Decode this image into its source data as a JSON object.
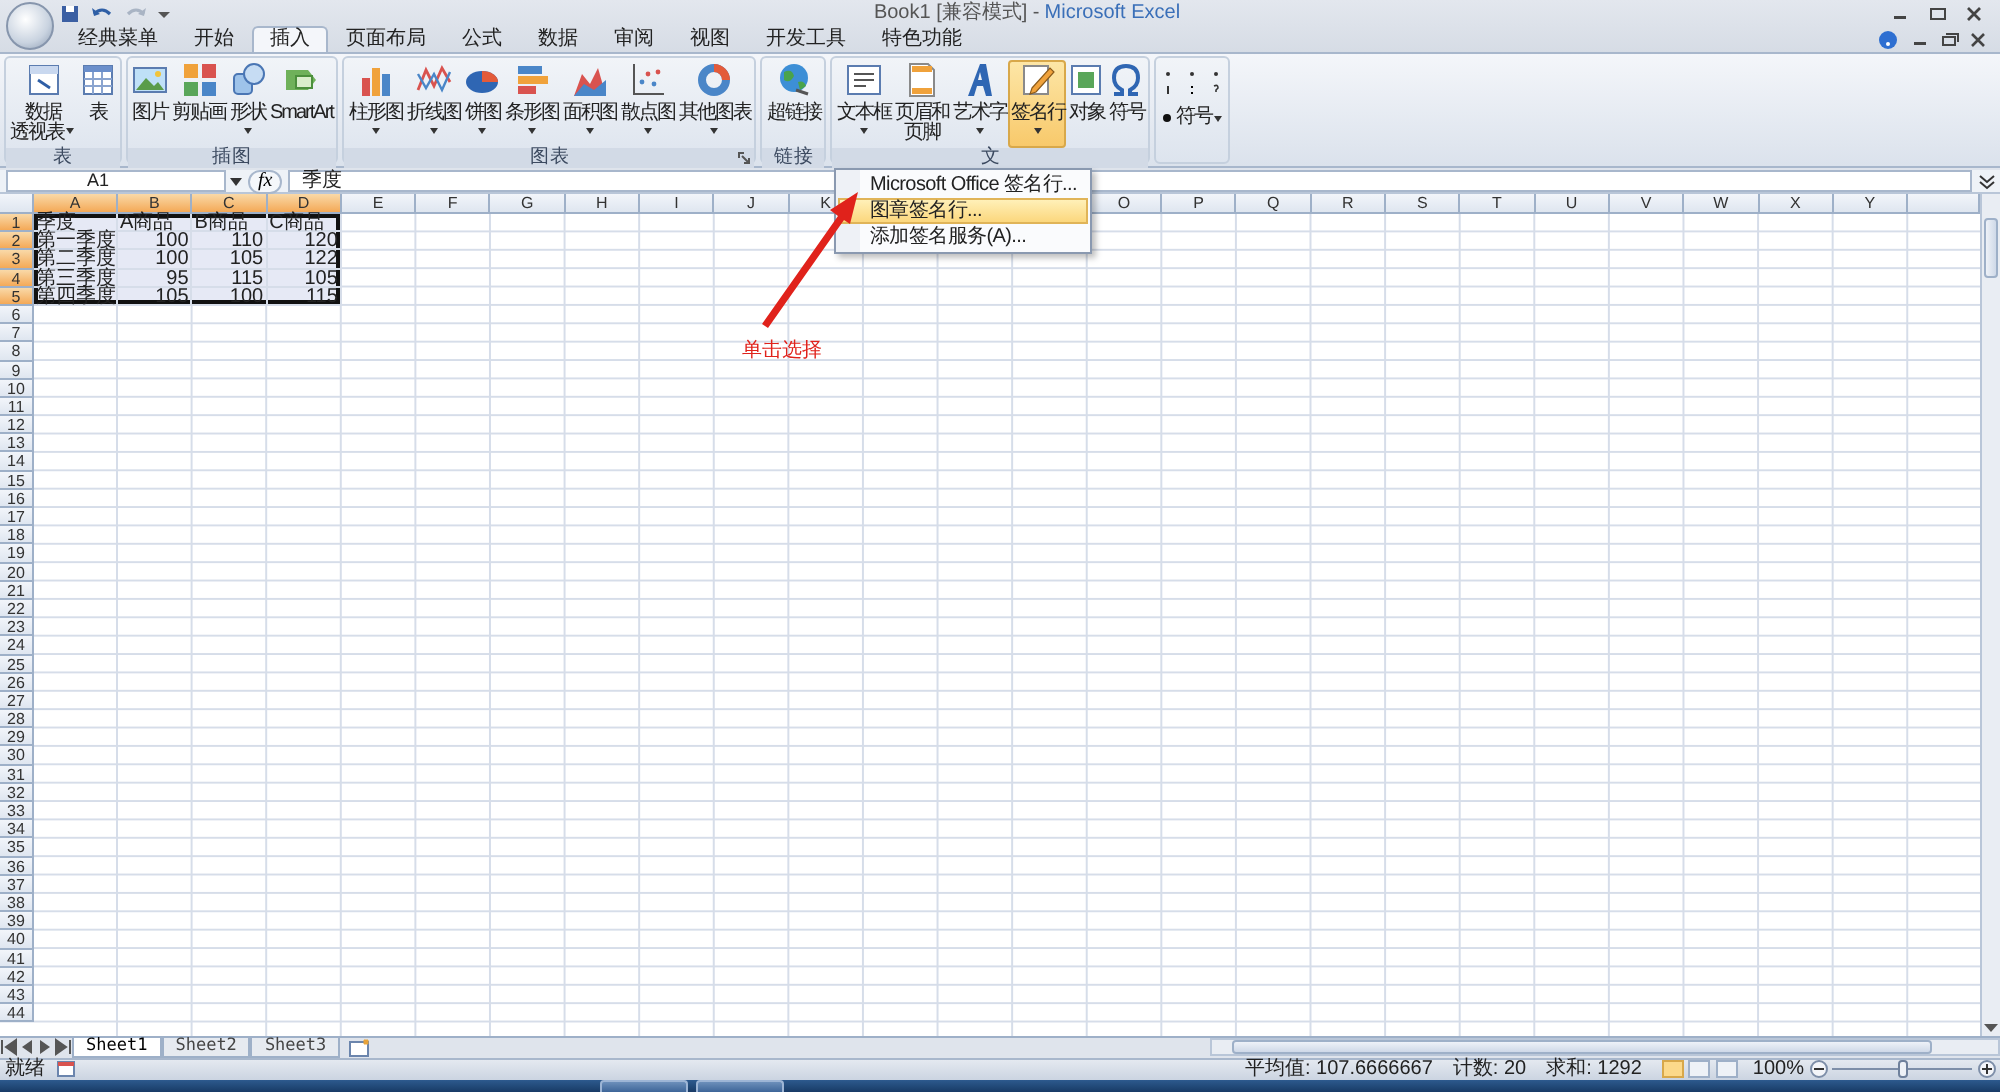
{
  "window": {
    "title_parts": [
      {
        "text": "Book1  [兼容模式]  -",
        "kind": "document"
      },
      {
        "text": "Microsoft Excel",
        "kind": "app"
      }
    ]
  },
  "tabs": [
    {
      "label": "经典菜单",
      "selected": false
    },
    {
      "label": "开始",
      "selected": false
    },
    {
      "label": "插入",
      "selected": true
    },
    {
      "label": "页面布局",
      "selected": false
    },
    {
      "label": "公式",
      "selected": false
    },
    {
      "label": "数据",
      "selected": false
    },
    {
      "label": "审阅",
      "selected": false
    },
    {
      "label": "视图",
      "selected": false
    },
    {
      "label": "开发工具",
      "selected": false
    },
    {
      "label": "特色功能",
      "selected": false
    }
  ],
  "ribbon": {
    "groups": [
      {
        "label": "表",
        "launcher": false,
        "buttons": [
          {
            "kind": "large",
            "lines": [
              "数据",
              "透视表"
            ],
            "dropdown": true,
            "pressed": false
          },
          {
            "kind": "large",
            "lines": [
              "表"
            ],
            "dropdown": false,
            "pressed": false
          }
        ]
      },
      {
        "label": "插图",
        "launcher": false,
        "buttons": [
          {
            "kind": "large",
            "lines": [
              "图片"
            ],
            "dropdown": false,
            "pressed": false
          },
          {
            "kind": "large",
            "lines": [
              "剪贴画"
            ],
            "dropdown": false,
            "pressed": false
          },
          {
            "kind": "large",
            "lines": [
              "形状"
            ],
            "dropdown": true,
            "pressed": false
          },
          {
            "kind": "large",
            "lines": [
              "SmartArt"
            ],
            "dropdown": false,
            "pressed": false
          }
        ]
      },
      {
        "label": "图表",
        "launcher": true,
        "buttons": [
          {
            "kind": "large",
            "lines": [
              "柱形图"
            ],
            "dropdown": true,
            "pressed": false
          },
          {
            "kind": "large",
            "lines": [
              "折线图"
            ],
            "dropdown": true,
            "pressed": false
          },
          {
            "kind": "large",
            "lines": [
              "饼图"
            ],
            "dropdown": true,
            "pressed": false
          },
          {
            "kind": "large",
            "lines": [
              "条形图"
            ],
            "dropdown": true,
            "pressed": false
          },
          {
            "kind": "large",
            "lines": [
              "面积图"
            ],
            "dropdown": true,
            "pressed": false
          },
          {
            "kind": "large",
            "lines": [
              "散点图"
            ],
            "dropdown": true,
            "pressed": false
          },
          {
            "kind": "large",
            "lines": [
              "其他图表"
            ],
            "dropdown": true,
            "pressed": false
          }
        ]
      },
      {
        "label": "链接",
        "launcher": false,
        "buttons": [
          {
            "kind": "large",
            "lines": [
              "超链接"
            ],
            "dropdown": false,
            "pressed": false
          }
        ]
      },
      {
        "label": "文",
        "launcher": false,
        "buttons": [
          {
            "kind": "large",
            "lines": [
              "文本框"
            ],
            "dropdown": true,
            "pressed": false
          },
          {
            "kind": "large",
            "lines": [
              "页眉和",
              "页脚"
            ],
            "dropdown": false,
            "pressed": false
          },
          {
            "kind": "large",
            "lines": [
              "艺术字"
            ],
            "dropdown": true,
            "pressed": false
          },
          {
            "kind": "large",
            "lines": [
              "签名行"
            ],
            "dropdown": true,
            "pressed": true,
            "menu": true
          },
          {
            "kind": "large",
            "lines": [
              "对象"
            ],
            "dropdown": false,
            "pressed": false
          },
          {
            "kind": "large",
            "lines": [
              "符号"
            ],
            "dropdown": false,
            "pressed": false
          }
        ]
      },
      {
        "buttons": [
          {
            "kind": "symbol",
            "lines": [
              "符号"
            ],
            "dropdown": true,
            "pressed": false
          }
        ]
      }
    ]
  },
  "signature_menu": {
    "items": [
      {
        "label": "Microsoft Office 签名行...",
        "selected": false
      },
      {
        "label": "图章签名行...",
        "selected": true
      },
      {
        "label": "添加签名服务(A)...",
        "selected": false
      }
    ]
  },
  "annotation": {
    "text": "单击选择"
  },
  "formula_bar": {
    "name_box": "A1",
    "insert_function": "fx",
    "formula": "季度"
  },
  "sheet": {
    "columns": [
      {
        "label": "A",
        "selected": true
      },
      {
        "label": "B",
        "selected": true
      },
      {
        "label": "C",
        "selected": true
      },
      {
        "label": "D",
        "selected": true
      },
      {
        "label": "E",
        "selected": false
      },
      {
        "label": "F",
        "selected": false
      },
      {
        "label": "G",
        "selected": false
      },
      {
        "label": "H",
        "selected": false
      },
      {
        "label": "I",
        "selected": false
      },
      {
        "label": "J",
        "selected": false
      },
      {
        "label": "K",
        "selected": false
      },
      null,
      null,
      null,
      {
        "label": "O",
        "selected": false
      },
      {
        "label": "P",
        "selected": false
      },
      {
        "label": "Q",
        "selected": false
      },
      {
        "label": "R",
        "selected": false
      },
      {
        "label": "S",
        "selected": false
      },
      {
        "label": "T",
        "selected": false
      },
      {
        "label": "U",
        "selected": false
      },
      {
        "label": "V",
        "selected": false
      },
      {
        "label": "W",
        "selected": false
      },
      {
        "label": "X",
        "selected": false
      },
      {
        "label": "Y",
        "selected": false
      }
    ],
    "rows": [
      {
        "header": "1",
        "selected": true,
        "kind": "heading",
        "cells": [
          "季度",
          "A商品",
          "B商品",
          "C商品"
        ]
      },
      {
        "header": "2",
        "selected": true,
        "kind": "values",
        "cells": [
          "第一季度",
          "100",
          "110",
          "120"
        ]
      },
      {
        "header": "3",
        "selected": true,
        "kind": "values",
        "cells": [
          "第二季度",
          "100",
          "105",
          "122"
        ]
      },
      {
        "header": "4",
        "selected": true,
        "kind": "values",
        "cells": [
          "第三季度",
          "95",
          "115",
          "105"
        ]
      },
      {
        "header": "5",
        "selected": true,
        "kind": "values",
        "cells": [
          "第四季度",
          "105",
          "100",
          "115"
        ]
      },
      {
        "header": "6",
        "selected": false
      },
      {
        "header": "7",
        "selected": false
      },
      {
        "header": "8",
        "selected": false
      },
      {
        "header": "9",
        "selected": false
      },
      {
        "header": "10",
        "selected": false
      },
      {
        "header": "11",
        "selected": false
      },
      {
        "header": "12",
        "selected": false
      },
      {
        "header": "13",
        "selected": false
      },
      {
        "header": "14",
        "selected": false
      },
      {
        "header": "15",
        "selected": false
      },
      {
        "header": "16",
        "selected": false
      },
      {
        "header": "17",
        "selected": false
      },
      {
        "header": "18",
        "selected": false
      },
      {
        "header": "19",
        "selected": false
      },
      {
        "header": "20",
        "selected": false
      },
      {
        "header": "21",
        "selected": false
      },
      {
        "header": "22",
        "selected": false
      },
      {
        "header": "23",
        "selected": false
      },
      {
        "header": "24",
        "selected": false
      },
      {
        "header": "25",
        "selected": false
      },
      {
        "header": "26",
        "selected": false
      },
      {
        "header": "27",
        "selected": false
      },
      {
        "header": "28",
        "selected": false
      },
      {
        "header": "29",
        "selected": false
      },
      {
        "header": "30",
        "selected": false
      },
      {
        "header": "31",
        "selected": false
      },
      {
        "header": "32",
        "selected": false
      },
      {
        "header": "33",
        "selected": false
      },
      {
        "header": "34",
        "selected": false
      },
      {
        "header": "35",
        "selected": false
      },
      {
        "header": "36",
        "selected": false
      },
      {
        "header": "37",
        "selected": false
      },
      {
        "header": "38",
        "selected": false
      },
      {
        "header": "39",
        "selected": false
      },
      {
        "header": "40",
        "selected": false
      },
      {
        "header": "41",
        "selected": false
      },
      {
        "header": "42",
        "selected": false
      },
      {
        "header": "43",
        "selected": false
      },
      {
        "header": "44",
        "selected": false
      }
    ]
  },
  "sheet_tabs": [
    {
      "label": "Sheet1",
      "selected": true
    },
    {
      "label": "Sheet2",
      "selected": false
    },
    {
      "label": "Sheet3",
      "selected": false
    }
  ],
  "status_bar": {
    "mode": "就绪",
    "average": "平均值: 107.6666667",
    "count": "计数: 20",
    "sum": "求和: 1292",
    "views": [
      {
        "selected": true
      },
      {
        "selected": false
      },
      {
        "selected": false
      }
    ],
    "zoom": "100%",
    "zoom_slider": {
      "level": 0.5
    }
  }
}
